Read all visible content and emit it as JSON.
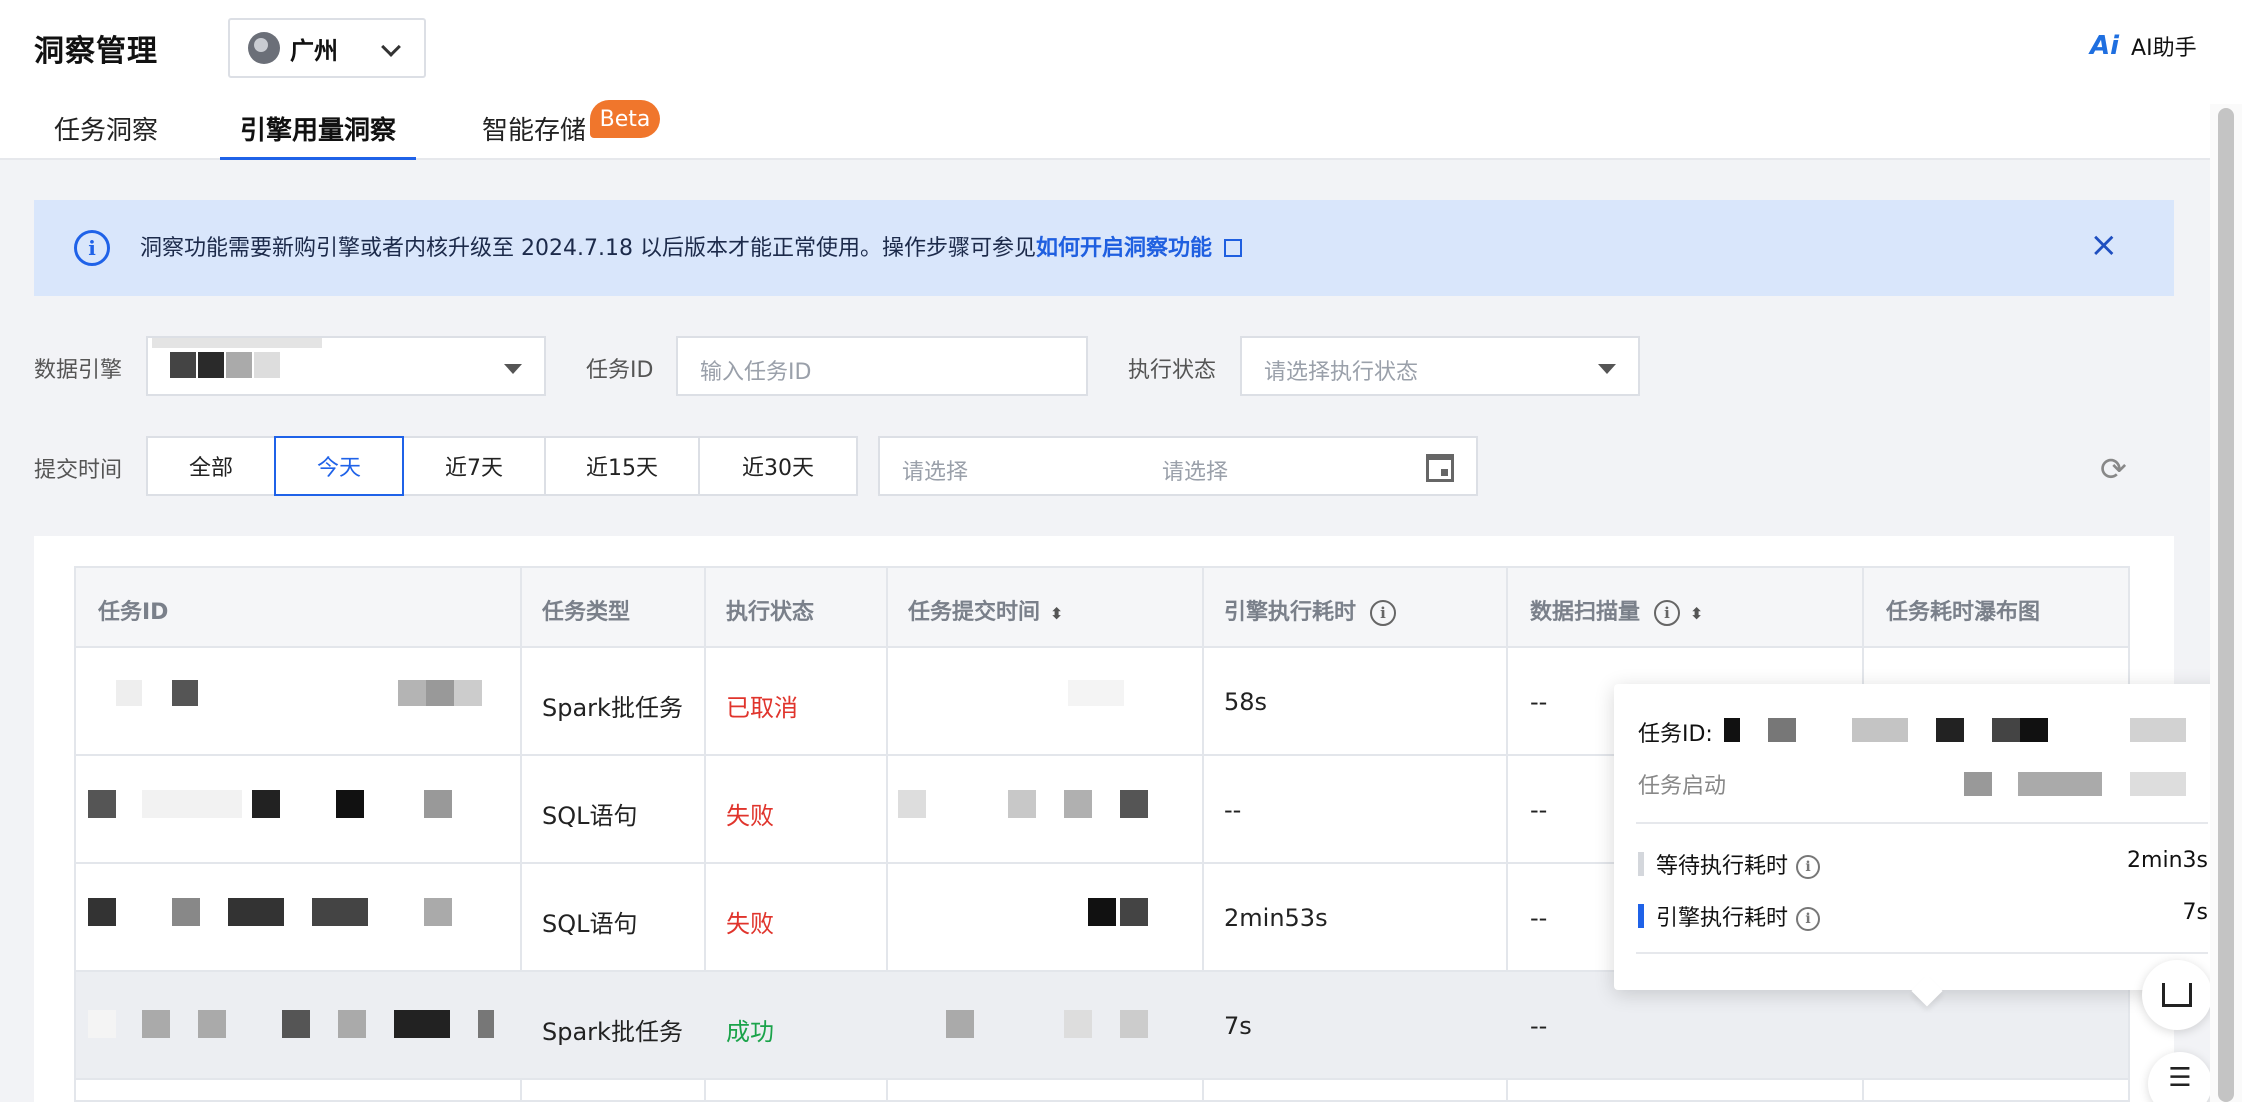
{
  "header": {
    "title": "洞察管理",
    "region": "广州",
    "ai_assistant": "AI助手",
    "ai_icon": "Ai"
  },
  "tabs": [
    {
      "label": "任务洞察",
      "active": false
    },
    {
      "label": "引擎用量洞察",
      "active": true
    },
    {
      "label": "智能存储",
      "active": false,
      "badge": "Beta"
    }
  ],
  "notice": {
    "text": "洞察功能需要新购引擎或者内核升级至 2024.7.18 以后版本才能正常使用。操作步骤可参见",
    "link": "如何开启洞察功能",
    "close_icon": "×"
  },
  "filters": {
    "engine_label": "数据引擎",
    "task_id_label": "任务ID",
    "task_id_placeholder": "输入任务ID",
    "status_label": "执行状态",
    "status_placeholder": "请选择执行状态",
    "submit_time_label": "提交时间",
    "time_options": [
      "全部",
      "今天",
      "近7天",
      "近15天",
      "近30天"
    ],
    "selected_time": "今天",
    "date_start_placeholder": "请选择",
    "date_end_placeholder": "请选择"
  },
  "table": {
    "columns": [
      "任务ID",
      "任务类型",
      "执行状态",
      "任务提交时间",
      "引擎执行耗时",
      "数据扫描量",
      "任务耗时瀑布图"
    ],
    "rows": [
      {
        "type": "Spark批任务",
        "status": "已取消",
        "status_color": "#e0342c",
        "engine_time": "58s",
        "scan": "--"
      },
      {
        "type": "SQL语句",
        "status": "失败",
        "status_color": "#e0342c",
        "engine_time": "--",
        "scan": "--"
      },
      {
        "type": "SQL语句",
        "status": "失败",
        "status_color": "#e0342c",
        "engine_time": "2min53s",
        "scan": "--"
      },
      {
        "type": "Spark批任务",
        "status": "成功",
        "status_color": "#1aa34a",
        "engine_time": "7s",
        "scan": "--"
      }
    ]
  },
  "popover": {
    "task_id_label": "任务ID:",
    "task_start_label": "任务启动",
    "wait_label": "等待执行耗时",
    "wait_value": "2min3s",
    "wait_color": "#d4d7dc",
    "engine_label": "引擎执行耗时",
    "engine_value": "7s",
    "engine_color": "#1f62e8"
  },
  "colors": {
    "accent": "#1f62e8",
    "beta": "#f0762c",
    "notice_bg": "#d9e6fb"
  }
}
